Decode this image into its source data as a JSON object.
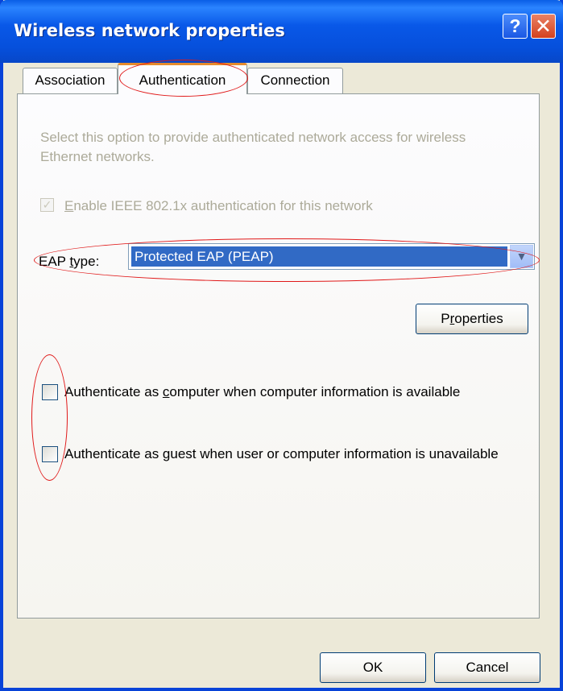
{
  "window": {
    "title": "Wireless network properties",
    "help_glyph": "?",
    "close_glyph": "✕"
  },
  "tabs": [
    {
      "label": "Association",
      "selected": false
    },
    {
      "label": "Authentication",
      "selected": true
    },
    {
      "label": "Connection",
      "selected": false
    }
  ],
  "auth": {
    "description": "Select this option to provide authenticated network access for wireless Ethernet networks.",
    "enable_8021x": {
      "label_prefix": "",
      "label_accel": "E",
      "label_rest": "nable IEEE 802.1x authentication for this network",
      "checked": true,
      "disabled": true
    },
    "eap": {
      "label_prefix": "EAP ",
      "label_accel": "t",
      "label_rest": "ype:",
      "selected_value": "Protected EAP (PEAP)"
    },
    "properties_button": {
      "label_prefix": "P",
      "label_accel": "r",
      "label_rest": "operties"
    },
    "auth_as_computer": {
      "label_prefix": "Authenticate as ",
      "label_accel": "c",
      "label_rest": "omputer when computer information is available",
      "checked": false
    },
    "auth_as_guest": {
      "label_prefix": "Authenticate as ",
      "label_accel": "g",
      "label_rest": "uest when user or computer information is unavailable",
      "checked": false
    }
  },
  "footer": {
    "ok_label": "OK",
    "cancel_label": "Cancel"
  },
  "annotation_color": "#e01818",
  "colors": {
    "title_bar": "#0958e8",
    "selection": "#316ac5",
    "dialog_bg": "#ece9d8"
  },
  "icons": {
    "help": "help-icon",
    "close": "close-icon",
    "dropdown": "chevron-down-icon",
    "check": "checkmark-icon"
  }
}
